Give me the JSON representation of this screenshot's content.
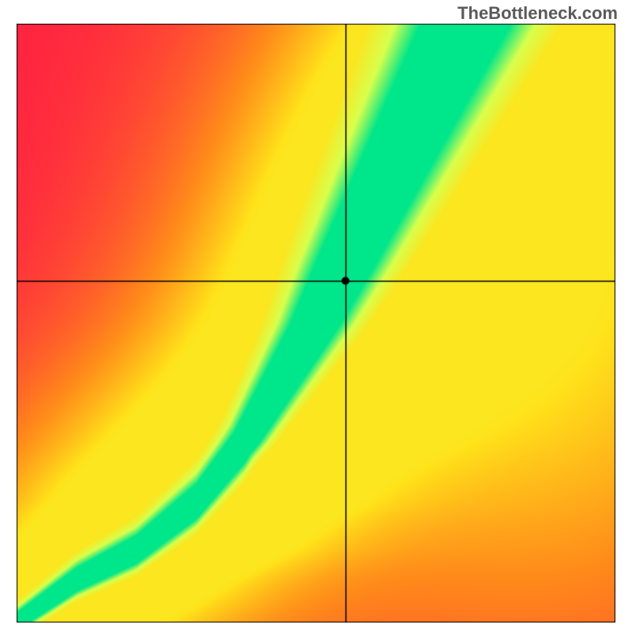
{
  "watermark": "TheBottleneck.com",
  "chart_data": {
    "type": "heatmap",
    "title": "",
    "xlabel": "",
    "ylabel": "",
    "xlim": [
      0,
      1
    ],
    "ylim": [
      0,
      1
    ],
    "crosshair": {
      "x": 0.55,
      "y": 0.57
    },
    "marker": {
      "x": 0.55,
      "y": 0.57
    },
    "colormap": {
      "stops": [
        {
          "t": 0.0,
          "color": "#ff1a44"
        },
        {
          "t": 0.35,
          "color": "#ff8a1a"
        },
        {
          "t": 0.6,
          "color": "#ffe31a"
        },
        {
          "t": 0.82,
          "color": "#d8ff4d"
        },
        {
          "t": 1.0,
          "color": "#00e68a"
        }
      ]
    },
    "ridge": {
      "description": "Green optimal curve approximated as polyline in normalized x→y",
      "points": [
        [
          0.0,
          0.0
        ],
        [
          0.1,
          0.07
        ],
        [
          0.2,
          0.12
        ],
        [
          0.3,
          0.2
        ],
        [
          0.38,
          0.3
        ],
        [
          0.44,
          0.4
        ],
        [
          0.5,
          0.5
        ],
        [
          0.55,
          0.6
        ],
        [
          0.6,
          0.7
        ],
        [
          0.65,
          0.8
        ],
        [
          0.7,
          0.9
        ],
        [
          0.75,
          1.0
        ]
      ],
      "width_profile": [
        [
          0.0,
          0.01
        ],
        [
          0.3,
          0.025
        ],
        [
          0.6,
          0.05
        ],
        [
          1.0,
          0.075
        ]
      ]
    },
    "background_field": "Smooth 2D gradient: top-left red, upper-right and lower-left yellow/orange lobes, bottom-right red, green along ridge"
  }
}
